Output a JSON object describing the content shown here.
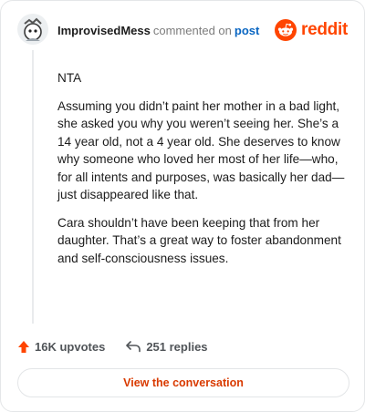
{
  "comment": {
    "username": "ImprovisedMess",
    "action": "commented on",
    "link_label": "post",
    "paragraphs": [
      "NTA",
      "Assuming you didn’t paint her mother in a bad light, she asked you why you weren’t seeing her. She’s a 14 year old, not a 4 year old. She deserves to know why someone who loved her most of her life—who, for all intents and purposes, was basically her dad—just disappeared like that.",
      "Cara shouldn’t have been keeping that from her daughter. That’s a great way to foster abandonment and self-consciousness issues."
    ]
  },
  "brand": {
    "wordmark": "reddit",
    "icon": "reddit-snoo-icon",
    "color": "#ff4500"
  },
  "stats": {
    "upvotes": "16K upvotes",
    "replies": "251 replies",
    "upvote_icon": "upvote-arrow-icon",
    "reply_icon": "reply-arrow-icon",
    "upvote_color": "#ff4500"
  },
  "cta": {
    "label": "View the conversation"
  }
}
